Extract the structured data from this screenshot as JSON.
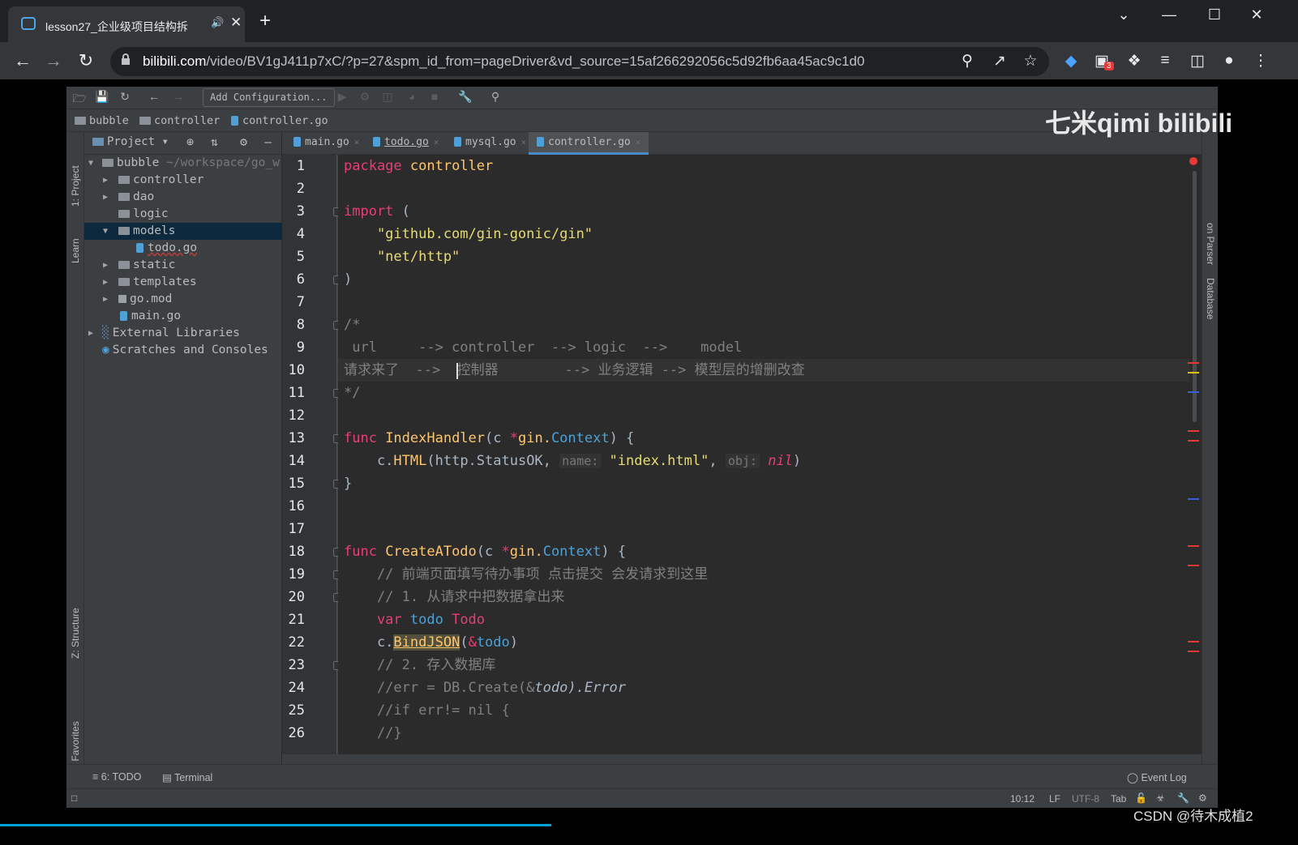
{
  "browser": {
    "tab_title": "lesson27_企业级项目结构拆",
    "url_domain": "bilibili.com",
    "url_path": "/video/BV1gJ411p7xC/?p=27&spm_id_from=pageDriver&vd_source=15af266292056c5d92fb6aa45ac9c1d0",
    "extension_badge": "3"
  },
  "ide": {
    "add_config_label": "Add Configuration...",
    "breadcrumb": [
      "bubble",
      "controller",
      "controller.go"
    ],
    "project_label": "Project",
    "tool_windows": {
      "project": "1: Project",
      "learn": "Learn",
      "structure": "Z: Structure",
      "favorites": "2: Favorites",
      "parser": "on Parser",
      "database": "Database"
    },
    "tree": [
      {
        "label": "bubble",
        "extra": "~/workspace/go_w"
      },
      {
        "label": "controller"
      },
      {
        "label": "dao"
      },
      {
        "label": "logic"
      },
      {
        "label": "models"
      },
      {
        "label": "todo.go"
      },
      {
        "label": "static"
      },
      {
        "label": "templates"
      },
      {
        "label": "go.mod"
      },
      {
        "label": "main.go"
      },
      {
        "label": "External Libraries"
      },
      {
        "label": "Scratches and Consoles"
      }
    ],
    "editor_tabs": [
      "main.go",
      "todo.go",
      "mysql.go",
      "controller.go"
    ],
    "line_numbers": [
      "1",
      "2",
      "3",
      "4",
      "5",
      "6",
      "7",
      "8",
      "9",
      "10",
      "11",
      "12",
      "13",
      "14",
      "15",
      "16",
      "17",
      "18",
      "19",
      "20",
      "21",
      "22",
      "23",
      "24",
      "25",
      "26"
    ],
    "code": {
      "l1_kw": "package",
      "l1_rest": " controller",
      "l3_kw": "import",
      "l3_rest": " (",
      "l4": "    \"github.com/gin-gonic/gin\"",
      "l5": "    \"net/http\"",
      "l6": ")",
      "l8": "/*",
      "l9": " url     --> controller  --> logic  -->    model",
      "l10": "请求来了  -->  控制器        --> 业务逻辑 --> 模型层的增删改查",
      "l11": "*/",
      "l13_kw": "func",
      "l13_fn": " IndexHandler",
      "l13_a": "(c ",
      "l13_star": "*",
      "l13_pkg": "gin.",
      "l13_ty": "Context",
      "l13_b": ") {",
      "l14_a": "    c.",
      "l14_m": "HTML",
      "l14_b": "(http.StatusOK, ",
      "l14_h1": "name:",
      "l14_s": " \"index.html\"",
      "l14_c": ", ",
      "l14_h2": "obj:",
      "l14_nil": " nil",
      "l14_d": ")",
      "l15": "}",
      "l18_kw": "func",
      "l18_fn": " CreateATodo",
      "l18_a": "(c ",
      "l18_star": "*",
      "l18_pkg": "gin.",
      "l18_ty": "Context",
      "l18_b": ") {",
      "l19": "    // 前端页面填写待办事项 点击提交 会发请求到这里",
      "l20": "    // 1. 从请求中把数据拿出来",
      "l21_kw": "    var",
      "l21_v": " todo",
      "l21_t": " Todo",
      "l22_a": "    c.",
      "l22_m": "BindJSON",
      "l22_p": "(",
      "l22_amp": "&",
      "l22_v": "todo",
      "l22_b": ")",
      "l23": "    // 2. 存入数据库",
      "l24_a": "    //err = DB.Create(&",
      "l24_it": "todo).Error",
      "l25": "    //if err!= nil {",
      "l26": "    //}"
    },
    "watermark": "七米qimi  bilibili",
    "bottom_tabs": {
      "todo": "6: TODO",
      "terminal": "Terminal",
      "event_log": "Event Log"
    },
    "status": {
      "position": "10:12",
      "line_sep": "LF",
      "encoding": "UTF-8",
      "indent": "Tab"
    }
  },
  "overlay": {
    "csdn": "CSDN @待木成植2"
  }
}
